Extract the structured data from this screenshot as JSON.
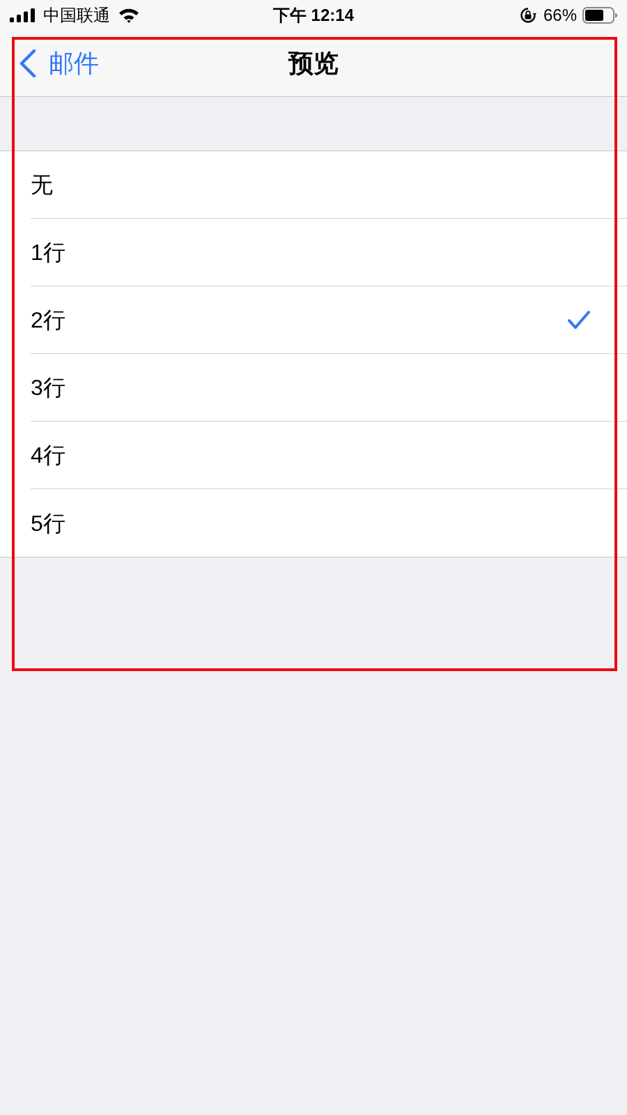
{
  "status_bar": {
    "carrier": "中国联通",
    "time": "下午 12:14",
    "battery": "66%"
  },
  "nav_bar": {
    "back": "邮件",
    "title": "预览"
  },
  "options": [
    {
      "label": "无",
      "selected": false
    },
    {
      "label": "1行",
      "selected": false
    },
    {
      "label": "2行",
      "selected": true
    },
    {
      "label": "3行",
      "selected": false
    },
    {
      "label": "4行",
      "selected": false
    },
    {
      "label": "5行",
      "selected": false
    }
  ]
}
